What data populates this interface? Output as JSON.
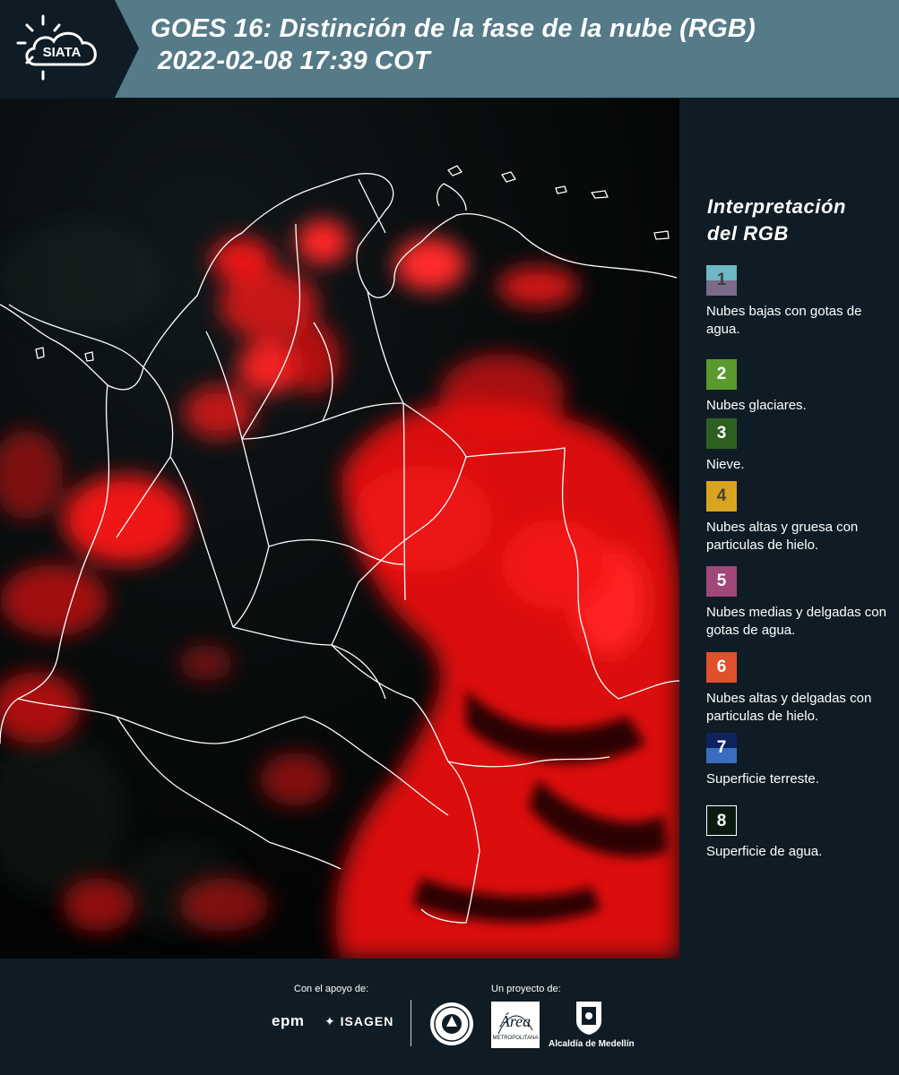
{
  "header": {
    "logo_text": "SIATA",
    "title_line1": "GOES 16: Distinción de la fase de la nube (RGB)",
    "title_line2": "2022-02-08 17:39 COT"
  },
  "legend": {
    "title_line1": "Interpretación",
    "title_line2": "del RGB",
    "items": [
      {
        "num": "1",
        "text": "Nubes bajas con gotas de agua.",
        "top_color": "#6fb8c6",
        "bottom_color": "#7c6a88",
        "num_color": "#3a3f48"
      },
      {
        "num": "2",
        "text": "Nubes glaciares.",
        "top_color": "#5a9a2c",
        "bottom_color": "#5a9a2c",
        "num_color": "#ffffff"
      },
      {
        "num": "3",
        "text": "Nieve.",
        "top_color": "#2d6020",
        "bottom_color": "#2d6020",
        "num_color": "#ffffff"
      },
      {
        "num": "4",
        "text": "Nubes altas y gruesa con particulas de hielo.",
        "top_color": "#d9a520",
        "bottom_color": "#d9a520",
        "num_color": "#4a4030"
      },
      {
        "num": "5",
        "text": "Nubes medias y delgadas con gotas de agua.",
        "top_color": "#a0487a",
        "bottom_color": "#a0487a",
        "num_color": "#ffffff"
      },
      {
        "num": "6",
        "text": "Nubes altas y delgadas con particulas de hielo.",
        "top_color": "#e0502a",
        "bottom_color": "#e0502a",
        "num_color": "#ffffff"
      },
      {
        "num": "7",
        "text": "Superficie terreste.",
        "top_color": "#0f2260",
        "bottom_color": "#3a6cc0",
        "num_color": "#ffffff"
      },
      {
        "num": "8",
        "text": "Superficie de agua.",
        "top_color": "#0a1a10",
        "bottom_color": "#0a1a10",
        "num_color": "#ffffff"
      }
    ]
  },
  "footer": {
    "support_label": "Con el apoyo de:",
    "project_label": "Un proyecto de:",
    "epm": "epm",
    "isagen": "ISAGEN",
    "area_text": "Área",
    "area_subtitle": "METROPOLITANA",
    "alcaldia": "Alcaldía de Medellín"
  }
}
